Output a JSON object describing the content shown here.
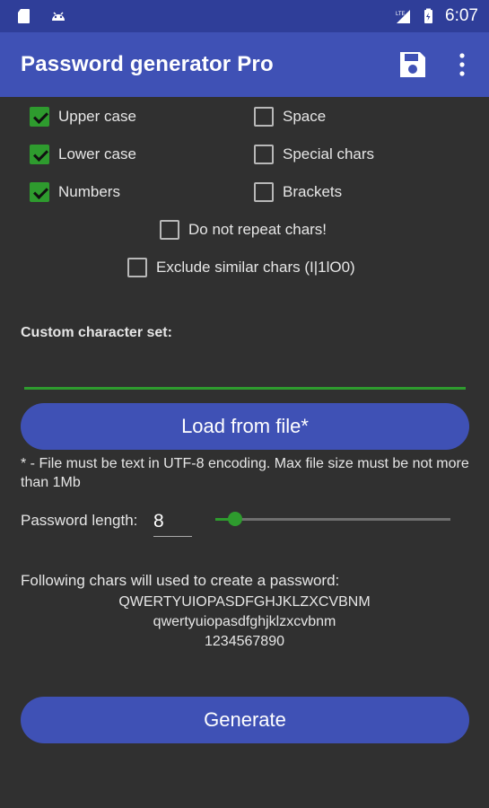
{
  "status_bar": {
    "time": "6:07",
    "left_icons": [
      "sd-card-icon",
      "android-icon"
    ],
    "right_icons": [
      "lte-signal-icon",
      "battery-charging-icon"
    ]
  },
  "app_bar": {
    "title": "Password generator Pro",
    "actions": [
      "save-icon",
      "more-vert-icon"
    ]
  },
  "options": {
    "upper_case": {
      "label": "Upper case",
      "checked": true
    },
    "lower_case": {
      "label": "Lower case",
      "checked": true
    },
    "numbers": {
      "label": "Numbers",
      "checked": true
    },
    "space": {
      "label": "Space",
      "checked": false
    },
    "special_chars": {
      "label": "Special chars",
      "checked": false
    },
    "brackets": {
      "label": "Brackets",
      "checked": false
    },
    "no_repeat": {
      "label": "Do not repeat chars!",
      "checked": false
    },
    "exclude_similar": {
      "label": "Exclude similar chars (I|1lO0)",
      "checked": false
    }
  },
  "custom_set": {
    "label": "Custom character set:",
    "value": ""
  },
  "load_button": "Load from file*",
  "file_note": "* - File must be text in UTF-8 encoding. Max file size must be not more than 1Mb",
  "length": {
    "label": "Password length:",
    "value": "8"
  },
  "chars_preview": {
    "title": "Following chars will used to create a password:",
    "lines": [
      "QWERTYUIOPASDFGHJKLZXCVBNM",
      "qwertyuiopasdfghjklzxcvbnm",
      "1234567890"
    ]
  },
  "generate_button": "Generate",
  "colors": {
    "primary": "#3f51b5",
    "primary_dark": "#2f3e99",
    "accent": "#2e9b2e",
    "background": "#303030"
  }
}
